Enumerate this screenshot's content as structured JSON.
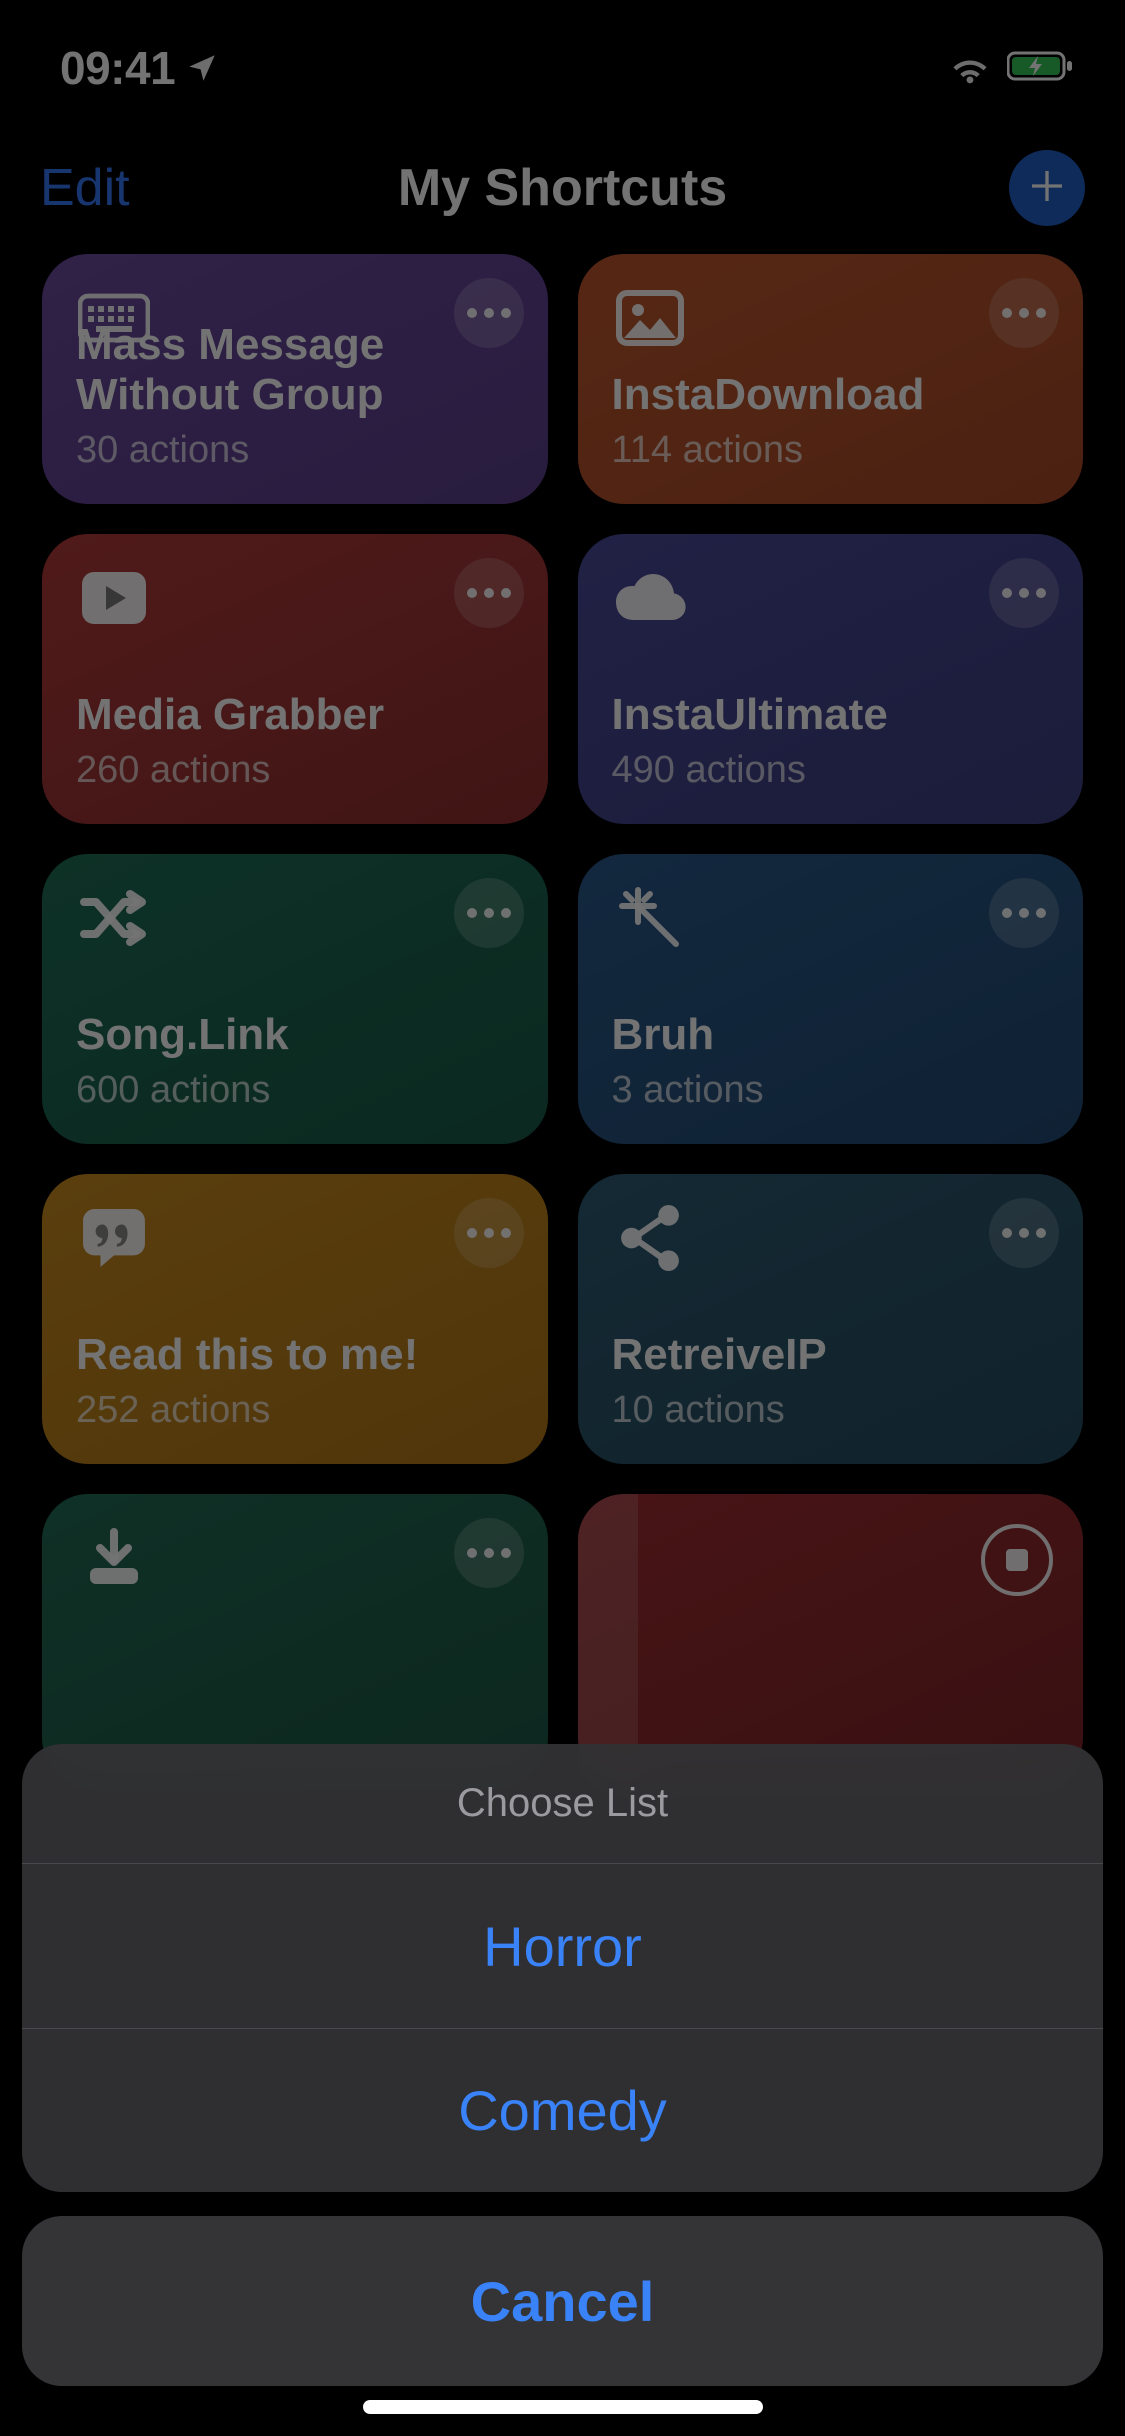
{
  "status_bar": {
    "time": "09:41"
  },
  "nav": {
    "edit_label": "Edit",
    "title": "My Shortcuts"
  },
  "cards": [
    {
      "title": "Mass Message Without Group",
      "subtitle": "30 actions",
      "color": "bg-purple",
      "icon": "keyboard-icon"
    },
    {
      "title": "InstaDownload",
      "subtitle": "114 actions",
      "color": "bg-orange",
      "icon": "image-icon"
    },
    {
      "title": "Media Grabber",
      "subtitle": "260 actions",
      "color": "bg-red",
      "icon": "play-icon"
    },
    {
      "title": "InstaUltimate",
      "subtitle": "490 actions",
      "color": "bg-indigo",
      "icon": "cloud-icon"
    },
    {
      "title": "Song.Link",
      "subtitle": "600 actions",
      "color": "bg-teal",
      "icon": "shuffle-icon"
    },
    {
      "title": "Bruh",
      "subtitle": "3 actions",
      "color": "bg-blue",
      "icon": "sparkle-icon"
    },
    {
      "title": "Read this to me!",
      "subtitle": "252 actions",
      "color": "bg-amber",
      "icon": "quote-icon"
    },
    {
      "title": "RetreiveIP",
      "subtitle": "10 actions",
      "color": "bg-slate",
      "icon": "share-icon"
    },
    {
      "title": "",
      "subtitle": "",
      "color": "bg-green2",
      "icon": "download-icon"
    },
    {
      "title": "",
      "subtitle": "",
      "color": "bg-crimson",
      "icon": "",
      "running": true
    }
  ],
  "action_sheet": {
    "title": "Choose List",
    "options": [
      "Horror",
      "Comedy"
    ],
    "cancel_label": "Cancel"
  }
}
